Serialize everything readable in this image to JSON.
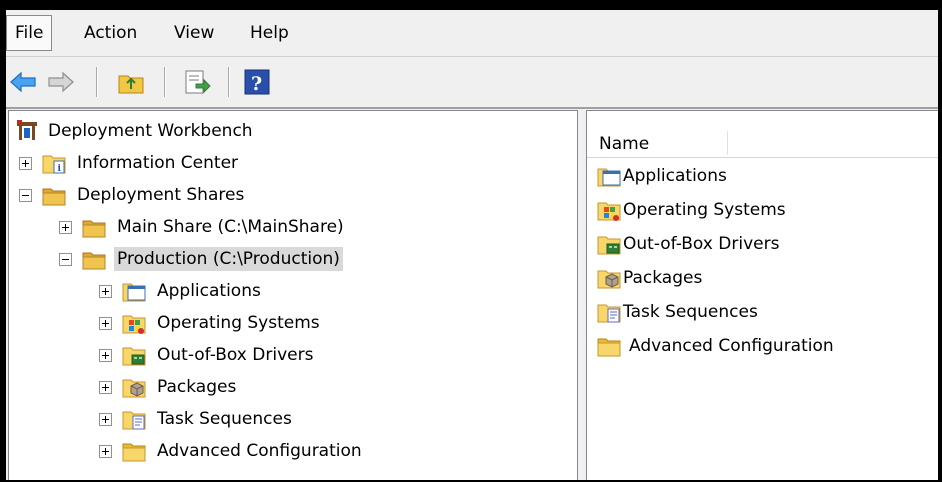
{
  "menubar": {
    "items": [
      {
        "label": "File"
      },
      {
        "label": "Action"
      },
      {
        "label": "View"
      },
      {
        "label": "Help"
      }
    ]
  },
  "toolbar": {
    "buttons": [
      "back-arrow-icon",
      "forward-arrow-icon",
      "up-folder-icon",
      "export-list-icon",
      "help-icon"
    ]
  },
  "tree": {
    "root": {
      "label": "Deployment Workbench"
    },
    "information_center": {
      "label": "Information Center"
    },
    "deployment_shares": {
      "label": "Deployment Shares"
    },
    "main_share": {
      "label": "Main Share (C:\\MainShare)"
    },
    "production": {
      "label": "Production (C:\\Production)"
    },
    "children": [
      {
        "label": "Applications"
      },
      {
        "label": "Operating Systems"
      },
      {
        "label": "Out-of-Box Drivers"
      },
      {
        "label": "Packages"
      },
      {
        "label": "Task Sequences"
      },
      {
        "label": "Advanced Configuration"
      }
    ]
  },
  "list": {
    "column_name": "Name",
    "items": [
      {
        "label": "Applications"
      },
      {
        "label": "Operating Systems"
      },
      {
        "label": "Out-of-Box Drivers"
      },
      {
        "label": "Packages"
      },
      {
        "label": "Task Sequences"
      },
      {
        "label": "Advanced Configuration"
      }
    ]
  },
  "colors": {
    "folder_yellow": "#f2c744",
    "selection_gray": "#d9d9d9",
    "arrow_blue": "#3a8ee6",
    "help_blue": "#2a4fa8"
  }
}
